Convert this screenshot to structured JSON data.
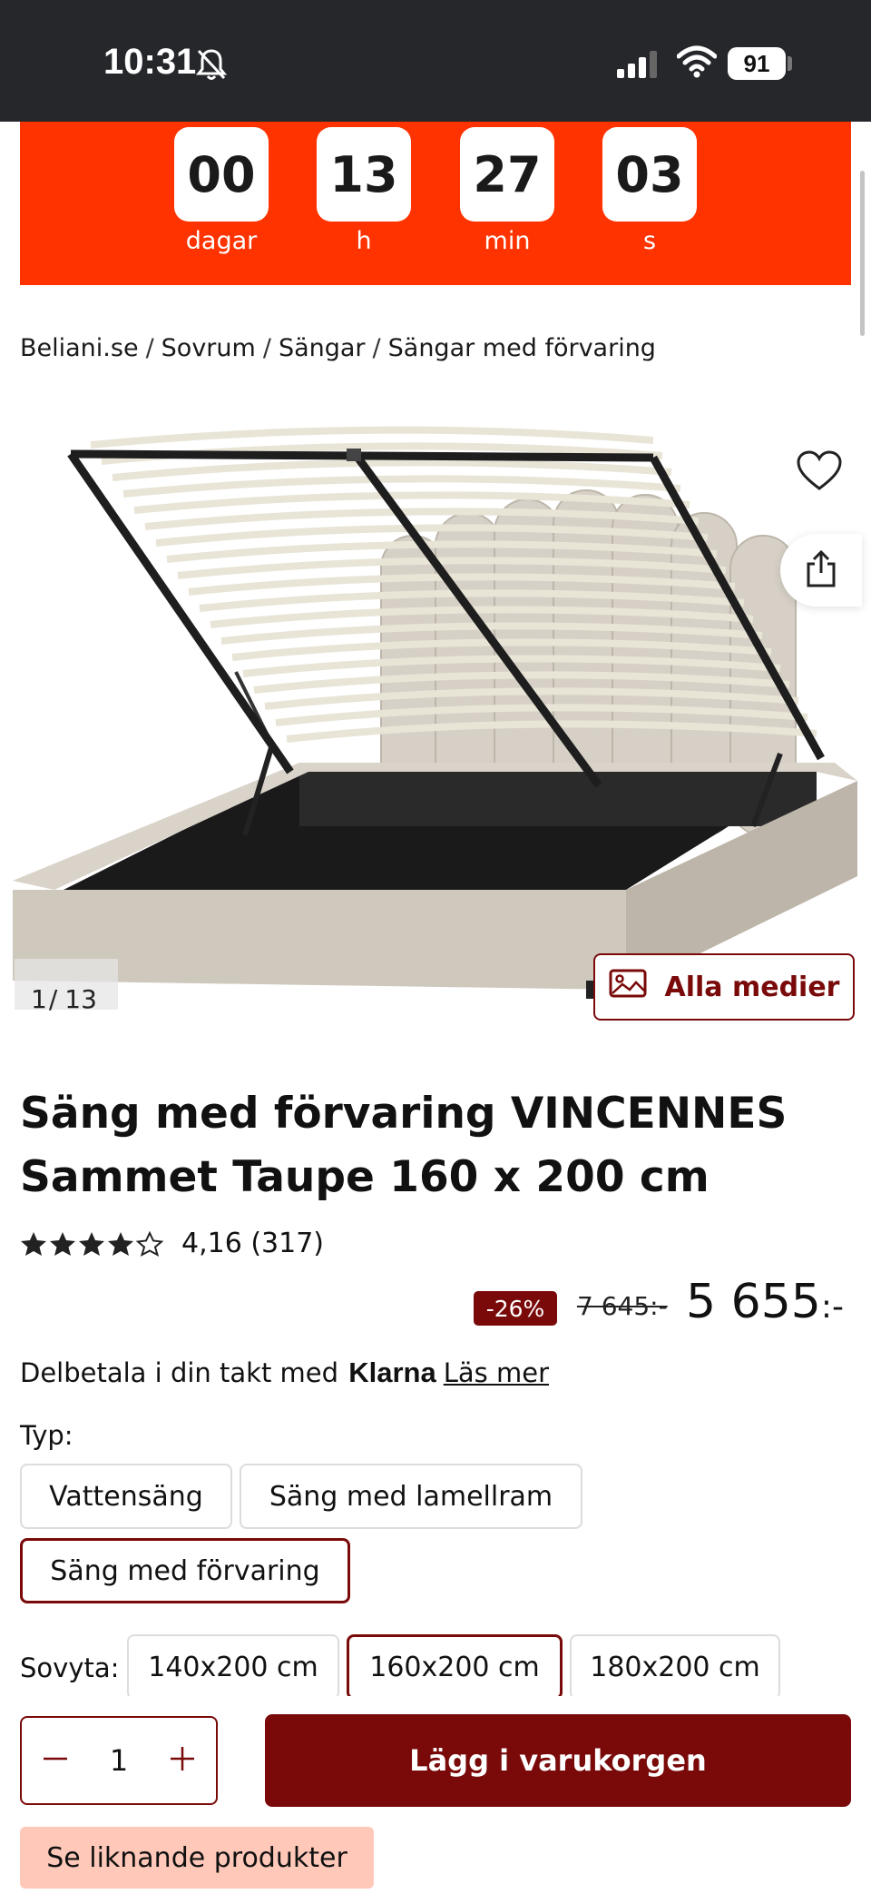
{
  "status_bar": {
    "time": "10:31",
    "battery": "91"
  },
  "countdown": {
    "units": [
      {
        "value": "00",
        "label": "dagar"
      },
      {
        "value": "13",
        "label": "h"
      },
      {
        "value": "27",
        "label": "min"
      },
      {
        "value": "03",
        "label": "s"
      }
    ]
  },
  "breadcrumb": [
    "Beliani.se",
    "Sovrum",
    "Sängar",
    "Sängar med förvaring"
  ],
  "gallery": {
    "current": "1",
    "total": "13",
    "all_media_label": "Alla medier"
  },
  "product": {
    "title_line1": "Säng med förvaring VINCENNES",
    "title_line2": "Sammet Taupe 160 x 200 cm",
    "rating_stars": 4.16,
    "rating_text": "4,16",
    "review_count": "(317)",
    "discount": "-26%",
    "old_price": "7 645:-",
    "price": "5 655",
    "price_suffix": ":-"
  },
  "klarna": {
    "text": "Delbetala i din takt med",
    "logo": "Klarna",
    "link": "Läs mer"
  },
  "options": {
    "type_label": "Typ:",
    "types": [
      "Vattensäng",
      "Säng med lamellram",
      "Säng med förvaring"
    ],
    "selected_type": "Säng med förvaring",
    "size_label": "Sovyta:",
    "sizes": [
      "140x200 cm",
      "160x200 cm",
      "180x200 cm"
    ],
    "selected_size": "160x200 cm"
  },
  "cart": {
    "quantity": "1",
    "add_label": "Lägg i varukorgen",
    "similar_label": "Se liknande produkter"
  },
  "colors": {
    "accent": "#7a0a0a",
    "banner": "#ff3300",
    "similar_bg": "#ffc8b8"
  }
}
